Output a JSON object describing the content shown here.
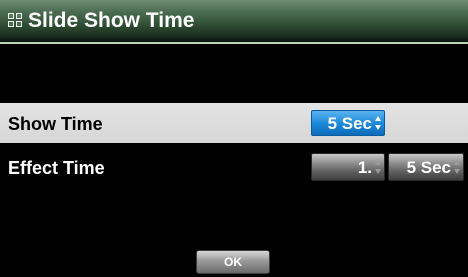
{
  "dialog": {
    "title": "Slide Show Time",
    "title_icon": "grid-icon"
  },
  "rows": {
    "show_time": {
      "label": "Show Time",
      "value": "5 Sec"
    },
    "effect_time": {
      "label": "Effect Time",
      "value_a": "1.",
      "value_b": "5 Sec"
    }
  },
  "buttons": {
    "ok_label": "OK"
  },
  "colors": {
    "title_bar": "#2f4d33",
    "selected_row": "#d6d6d6",
    "active_spinner": "#1a87d8",
    "inactive_spinner": "#5d5d5d",
    "background": "#000000"
  }
}
